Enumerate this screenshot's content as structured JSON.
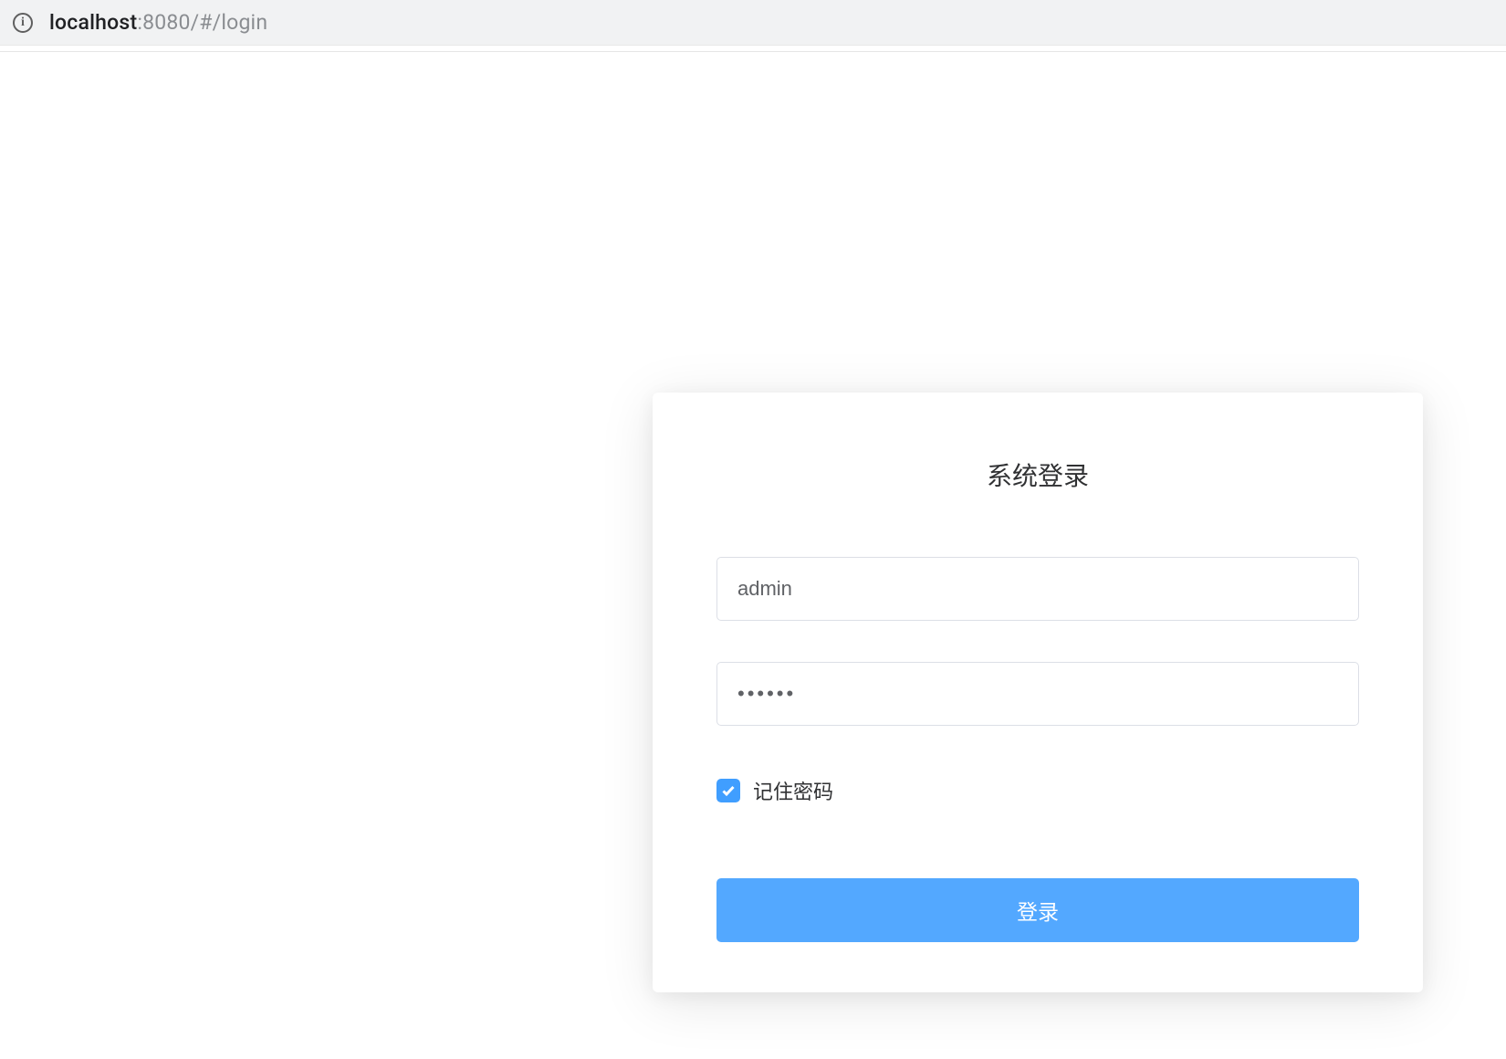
{
  "addressBar": {
    "host": "localhost",
    "portPath": ":8080/#/login"
  },
  "login": {
    "title": "系统登录",
    "username_value": "admin",
    "password_display": "••••••",
    "remember_label": "记住密码",
    "remember_checked": true,
    "submit_label": "登录"
  }
}
